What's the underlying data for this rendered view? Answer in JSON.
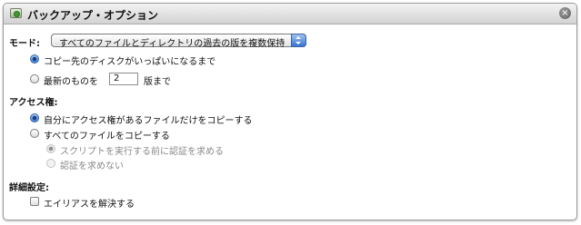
{
  "title": "バックアップ・オプション",
  "close_glyph": "×",
  "mode": {
    "label": "モード:",
    "select_value": "すべてのファイルとディレクトリの過去の版を複数保持",
    "options": [
      {
        "label": "コピー先のディスクがいっぱいになるまで",
        "selected": true
      },
      {
        "label_prefix": "最新のものを",
        "count": "2",
        "label_suffix": "版まで",
        "selected": false
      }
    ]
  },
  "access": {
    "label": "アクセス権:",
    "options": [
      {
        "label": "自分にアクセス権があるファイルだけをコピーする",
        "selected": true
      },
      {
        "label": "すべてのファイルをコピーする",
        "selected": false
      }
    ],
    "sub_options": [
      {
        "label": "スクリプトを実行する前に認証を求める",
        "selected": true,
        "enabled": false
      },
      {
        "label": "認証を求めない",
        "selected": false,
        "enabled": false
      }
    ]
  },
  "advanced": {
    "label": "詳細設定:",
    "resolve_aliases_label": "エイリアスを解決する",
    "resolve_aliases_checked": false
  }
}
